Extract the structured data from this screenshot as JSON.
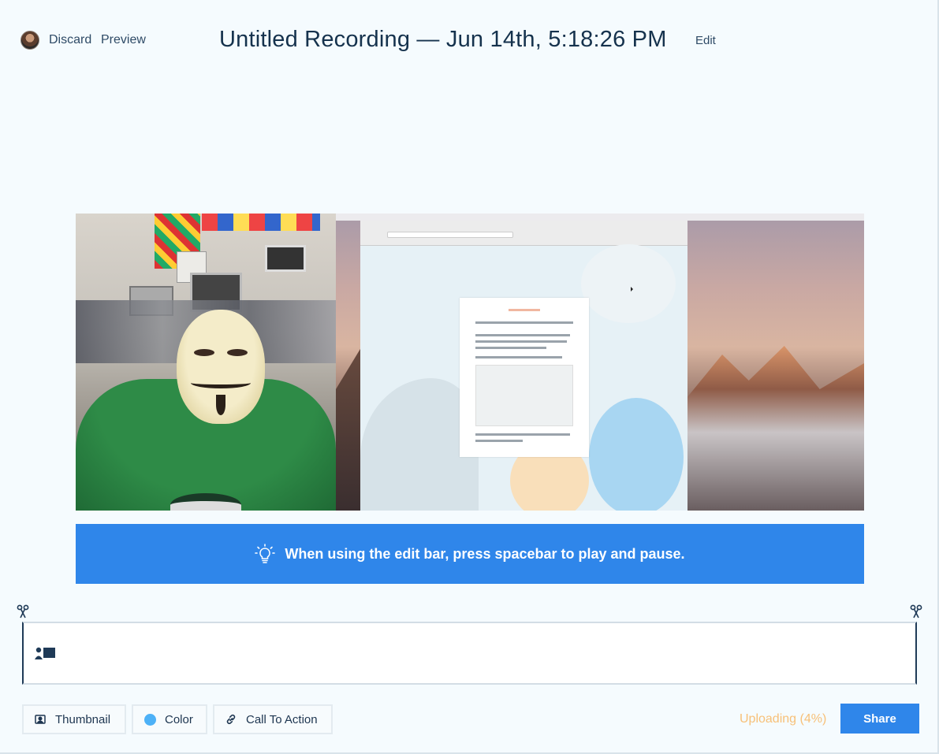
{
  "header": {
    "discard_label": "Discard",
    "preview_label": "Preview",
    "title": "Untitled Recording — Jun 14th, 5:18:26 PM",
    "edit_label": "Edit"
  },
  "tip": {
    "text": "When using the edit bar, press spacebar to play and pause."
  },
  "toolbar": {
    "thumbnail_label": "Thumbnail",
    "color_label": "Color",
    "color_swatch": "#4db1f7",
    "cta_label": "Call To Action",
    "upload_status": "Uploading (4%)",
    "upload_progress_percent": 4,
    "share_label": "Share"
  },
  "colors": {
    "accent": "#2f86ea",
    "upload_status": "#f7c078",
    "title": "#15324d"
  },
  "icons": {
    "avatar": "user-avatar",
    "tip": "lightbulb-icon",
    "trim": "scissors-icon",
    "timeline": "camera-screen-icon",
    "thumbnail": "image-icon",
    "color": "color-dot-icon",
    "cta": "link-icon"
  }
}
